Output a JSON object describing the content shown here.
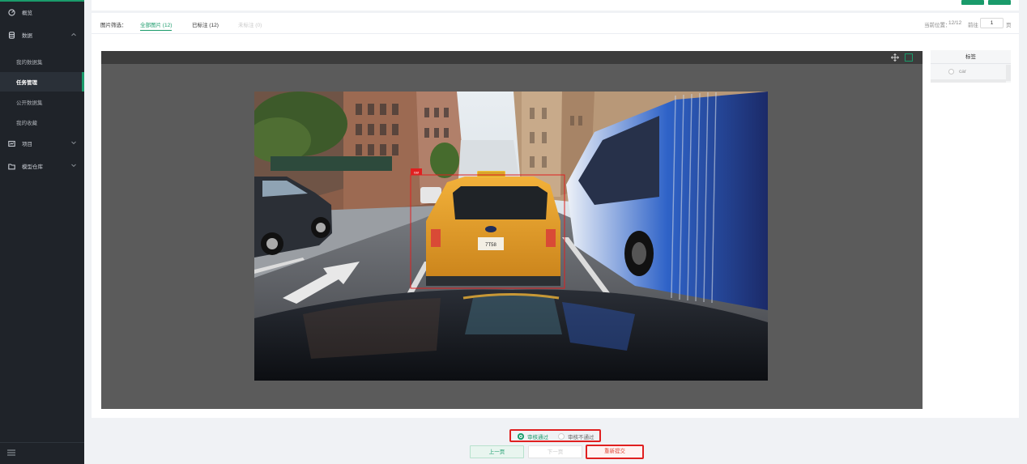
{
  "sidebar": {
    "items": [
      {
        "label": "概览",
        "icon": "dashboard-icon"
      },
      {
        "label": "数据",
        "icon": "database-icon",
        "expanded": true
      },
      {
        "label": "项目",
        "icon": "project-icon"
      },
      {
        "label": "模型仓库",
        "icon": "folder-icon"
      }
    ],
    "sub_items": [
      {
        "label": "我的数据集",
        "active": false
      },
      {
        "label": "任务管理",
        "active": true
      },
      {
        "label": "公开数据集",
        "active": false
      },
      {
        "label": "我的收藏",
        "active": false
      }
    ],
    "collapse_icon": "menu-collapse-icon"
  },
  "filter": {
    "label": "图片筛选：",
    "tabs": [
      {
        "label": "全部图片 (12)",
        "state": "active"
      },
      {
        "label": "已标注 (12)",
        "state": "normal"
      },
      {
        "label": "未标注 (0)",
        "state": "disabled"
      }
    ],
    "position_label": "当前位置：",
    "position_value": "12/12",
    "goto_label": "前往",
    "page_value": "1",
    "page_suffix": "页"
  },
  "canvas": {
    "tools": [
      "move-icon",
      "rectangle-tool-icon"
    ],
    "annotation_label": "car"
  },
  "label_panel": {
    "header": "标签",
    "options": [
      {
        "label": "car"
      }
    ]
  },
  "review": {
    "options": [
      {
        "label": "审核通过",
        "selected": true
      },
      {
        "label": "审核不通过",
        "selected": false
      }
    ]
  },
  "buttons": {
    "prev": "上一页",
    "next": "下一页",
    "resubmit": "重新提交"
  },
  "colors": {
    "accent": "#1a9b6b",
    "sidebar_bg": "#1f2329",
    "highlight_red": "#e02020"
  }
}
